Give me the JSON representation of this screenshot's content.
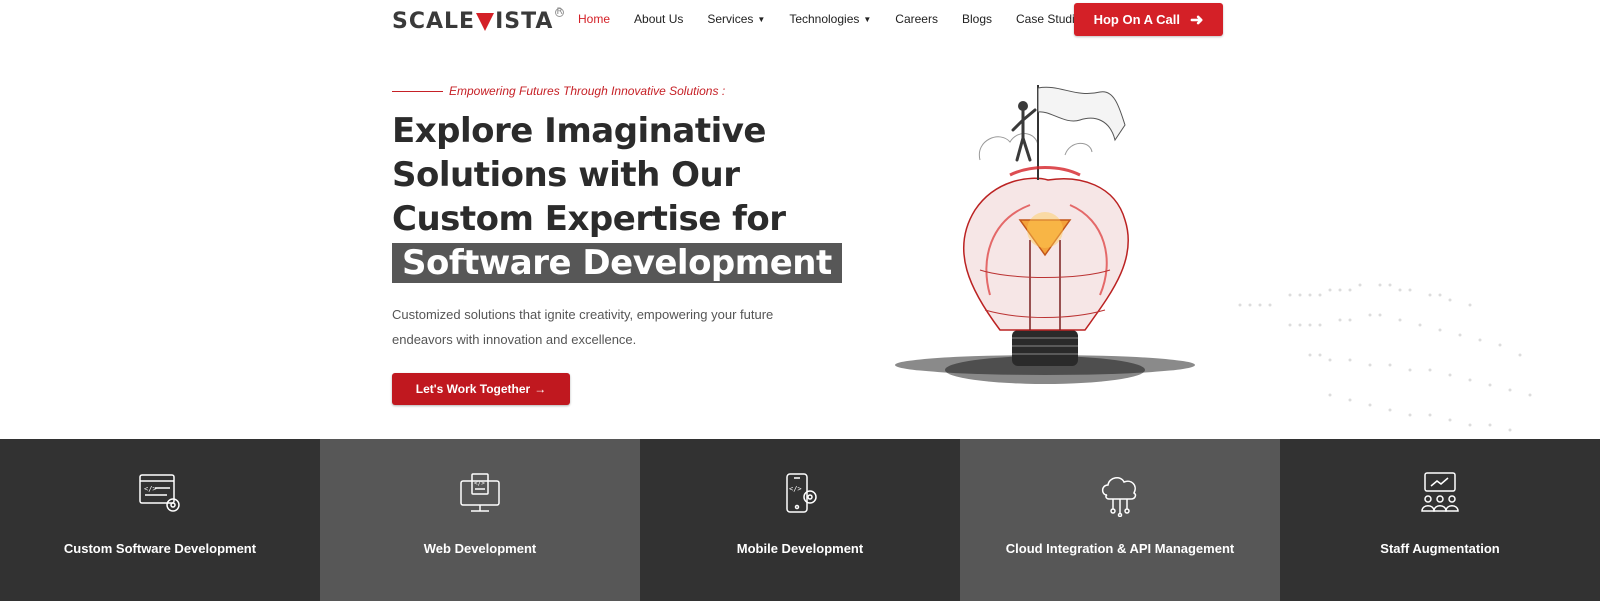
{
  "header": {
    "logo_left": "SCALE",
    "logo_right": "ISTA",
    "nav": [
      {
        "label": "Home",
        "active": true,
        "dropdown": false
      },
      {
        "label": "About Us",
        "active": false,
        "dropdown": false
      },
      {
        "label": "Services",
        "active": false,
        "dropdown": true
      },
      {
        "label": "Technologies",
        "active": false,
        "dropdown": true
      },
      {
        "label": "Careers",
        "active": false,
        "dropdown": false
      },
      {
        "label": "Blogs",
        "active": false,
        "dropdown": false
      },
      {
        "label": "Case Studies",
        "active": false,
        "dropdown": false
      }
    ],
    "cta_label": "Hop On A Call",
    "cta_icon": "arrow-right-icon"
  },
  "hero": {
    "tagline": "Empowering Futures Through Innovative Solutions :",
    "headline_line1": "Explore Imaginative",
    "headline_line2": "Solutions with Our",
    "headline_line3": "Custom Expertise for",
    "headline_highlight": "Software Development",
    "description": "Customized solutions that ignite creativity, empowering your future endeavors with innovation and excellence.",
    "button_label": "Let's Work Together",
    "button_icon": "arrow-right-icon"
  },
  "services": [
    {
      "label": "Custom Software Development",
      "icon": "code-window-gear-icon",
      "tone": "dark"
    },
    {
      "label": "Web Development",
      "icon": "monitor-code-icon",
      "tone": "mid"
    },
    {
      "label": "Mobile Development",
      "icon": "mobile-code-gear-icon",
      "tone": "dark"
    },
    {
      "label": "Cloud Integration & API Management",
      "icon": "cloud-network-icon",
      "tone": "mid"
    },
    {
      "label": "Staff Augmentation",
      "icon": "team-growth-icon",
      "tone": "dark"
    }
  ],
  "colors": {
    "brand_red": "#d42027",
    "dark_panel": "#323232",
    "mid_panel": "#575757",
    "highlight_bg": "#575757"
  }
}
